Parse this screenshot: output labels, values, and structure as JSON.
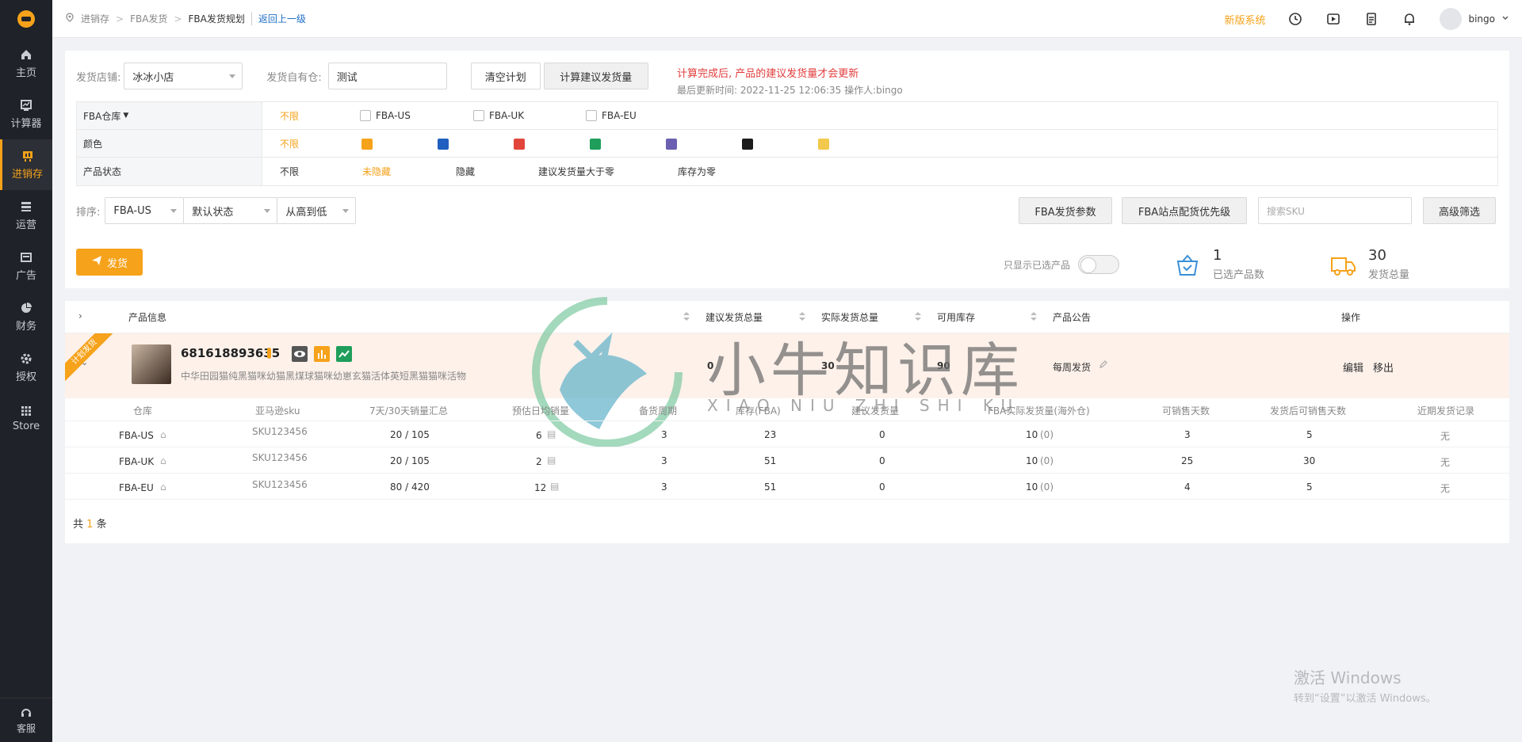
{
  "sidebar": {
    "items": [
      {
        "label": "主页",
        "icon": "home-icon"
      },
      {
        "label": "计算器",
        "icon": "calculator-icon"
      },
      {
        "label": "进销存",
        "icon": "inventory-icon"
      },
      {
        "label": "运营",
        "icon": "operations-icon"
      },
      {
        "label": "广告",
        "icon": "ad-icon"
      },
      {
        "label": "财务",
        "icon": "finance-icon"
      },
      {
        "label": "授权",
        "icon": "authorize-icon"
      },
      {
        "label": "Store",
        "icon": "store-icon"
      }
    ],
    "active_index": 2,
    "bottom": {
      "label": "客服",
      "icon": "headset-icon"
    }
  },
  "breadcrumb": {
    "items": [
      "进销存",
      "FBA发货",
      "FBA发货规划"
    ],
    "back": "返回上一级"
  },
  "topbar": {
    "new_system": "新版系统",
    "username": "bingo"
  },
  "form": {
    "shop_label": "发货店铺:",
    "shop_value": "冰冰小店",
    "warehouse_label": "发货自有仓:",
    "warehouse_value": "测试",
    "clear_plan": "清空计划",
    "calc_suggest": "计算建议发货量",
    "note_red": "计算完成后, 产品的建议发货量才会更新",
    "note_updated": "最后更新时间: 2022-11-25 12:06:35 操作人:bingo"
  },
  "filters": {
    "fba_label": "FBA仓库",
    "fba_options": [
      "不限",
      "FBA-US",
      "FBA-UK",
      "FBA-EU"
    ],
    "color_label": "颜色",
    "color_any": "不限",
    "colors": [
      "#f6a21a",
      "#1f5fbf",
      "#e2463b",
      "#1e9e5a",
      "#6a5fb0",
      "#1c1c1c",
      "#f2c94c"
    ],
    "status_label": "产品状态",
    "status_options": [
      "不限",
      "未隐藏",
      "隐藏",
      "建议发货量大于零",
      "库存为零"
    ]
  },
  "sort": {
    "label": "排序:",
    "field": "FBA-US",
    "state": "默认状态",
    "order": "从高到低",
    "btn_params": "FBA发货参数",
    "btn_priority": "FBA站点配货优先级",
    "search_placeholder": "搜索SKU",
    "btn_advanced": "高级筛选"
  },
  "actions": {
    "ship": "发货",
    "only_selected": "只显示已选产品",
    "selected_count": "1",
    "selected_label": "已选产品数",
    "total_qty": "30",
    "total_label": "发货总量"
  },
  "table": {
    "headers": {
      "product": "产品信息",
      "suggest_total": "建议发货总量",
      "actual_total": "实际发货总量",
      "available": "可用库存",
      "notice": "产品公告",
      "ops": "操作"
    },
    "product": {
      "ribbon": "计划发货",
      "id": "681618893635",
      "name": "中华田园猫纯黑猫咪幼猫黑煤球猫咪幼崽玄猫活体英短黑猫猫咪活物",
      "suggest_total": "0",
      "actual_total": "30",
      "available": "90",
      "notice": "每周发货",
      "edit": "编辑",
      "remove": "移出"
    },
    "sub_headers": [
      "仓库",
      "亚马逊sku",
      "7天/30天销量汇总",
      "预估日均销量",
      "备货周期",
      "库存(FBA)",
      "建议发货量",
      "FBA实际发货量(海外仓)",
      "可销售天数",
      "发货后可销售天数",
      "近期发货记录"
    ],
    "rows": [
      {
        "warehouse": "FBA-US",
        "sku": "SKU123456",
        "sales": "20 / 105",
        "daily": "6",
        "cycle": "3",
        "stock": "23",
        "suggest": "0",
        "actual": "10",
        "actual_paren": "(0)",
        "days": "3",
        "days_after": "5",
        "recent": "无"
      },
      {
        "warehouse": "FBA-UK",
        "sku": "SKU123456",
        "sales": "20 / 105",
        "daily": "2",
        "cycle": "3",
        "stock": "51",
        "suggest": "0",
        "actual": "10",
        "actual_paren": "(0)",
        "days": "25",
        "days_after": "30",
        "recent": "无"
      },
      {
        "warehouse": "FBA-EU",
        "sku": "SKU123456",
        "sales": "80 / 420",
        "daily": "12",
        "cycle": "3",
        "stock": "51",
        "suggest": "0",
        "actual": "10",
        "actual_paren": "(0)",
        "days": "4",
        "days_after": "5",
        "recent": "无"
      }
    ],
    "total_prefix": "共",
    "total_count": "1",
    "total_suffix": "条"
  },
  "watermark": {
    "logo_text": "小牛知识库",
    "logo_sub": "XIAO NIU ZHI SHI KU",
    "win_title": "激活 Windows",
    "win_sub": "转到“设置”以激活 Windows。"
  },
  "colors": {
    "accent": "#f6a21a",
    "link": "#1f6fc5",
    "sidebar": "#1f2329"
  }
}
